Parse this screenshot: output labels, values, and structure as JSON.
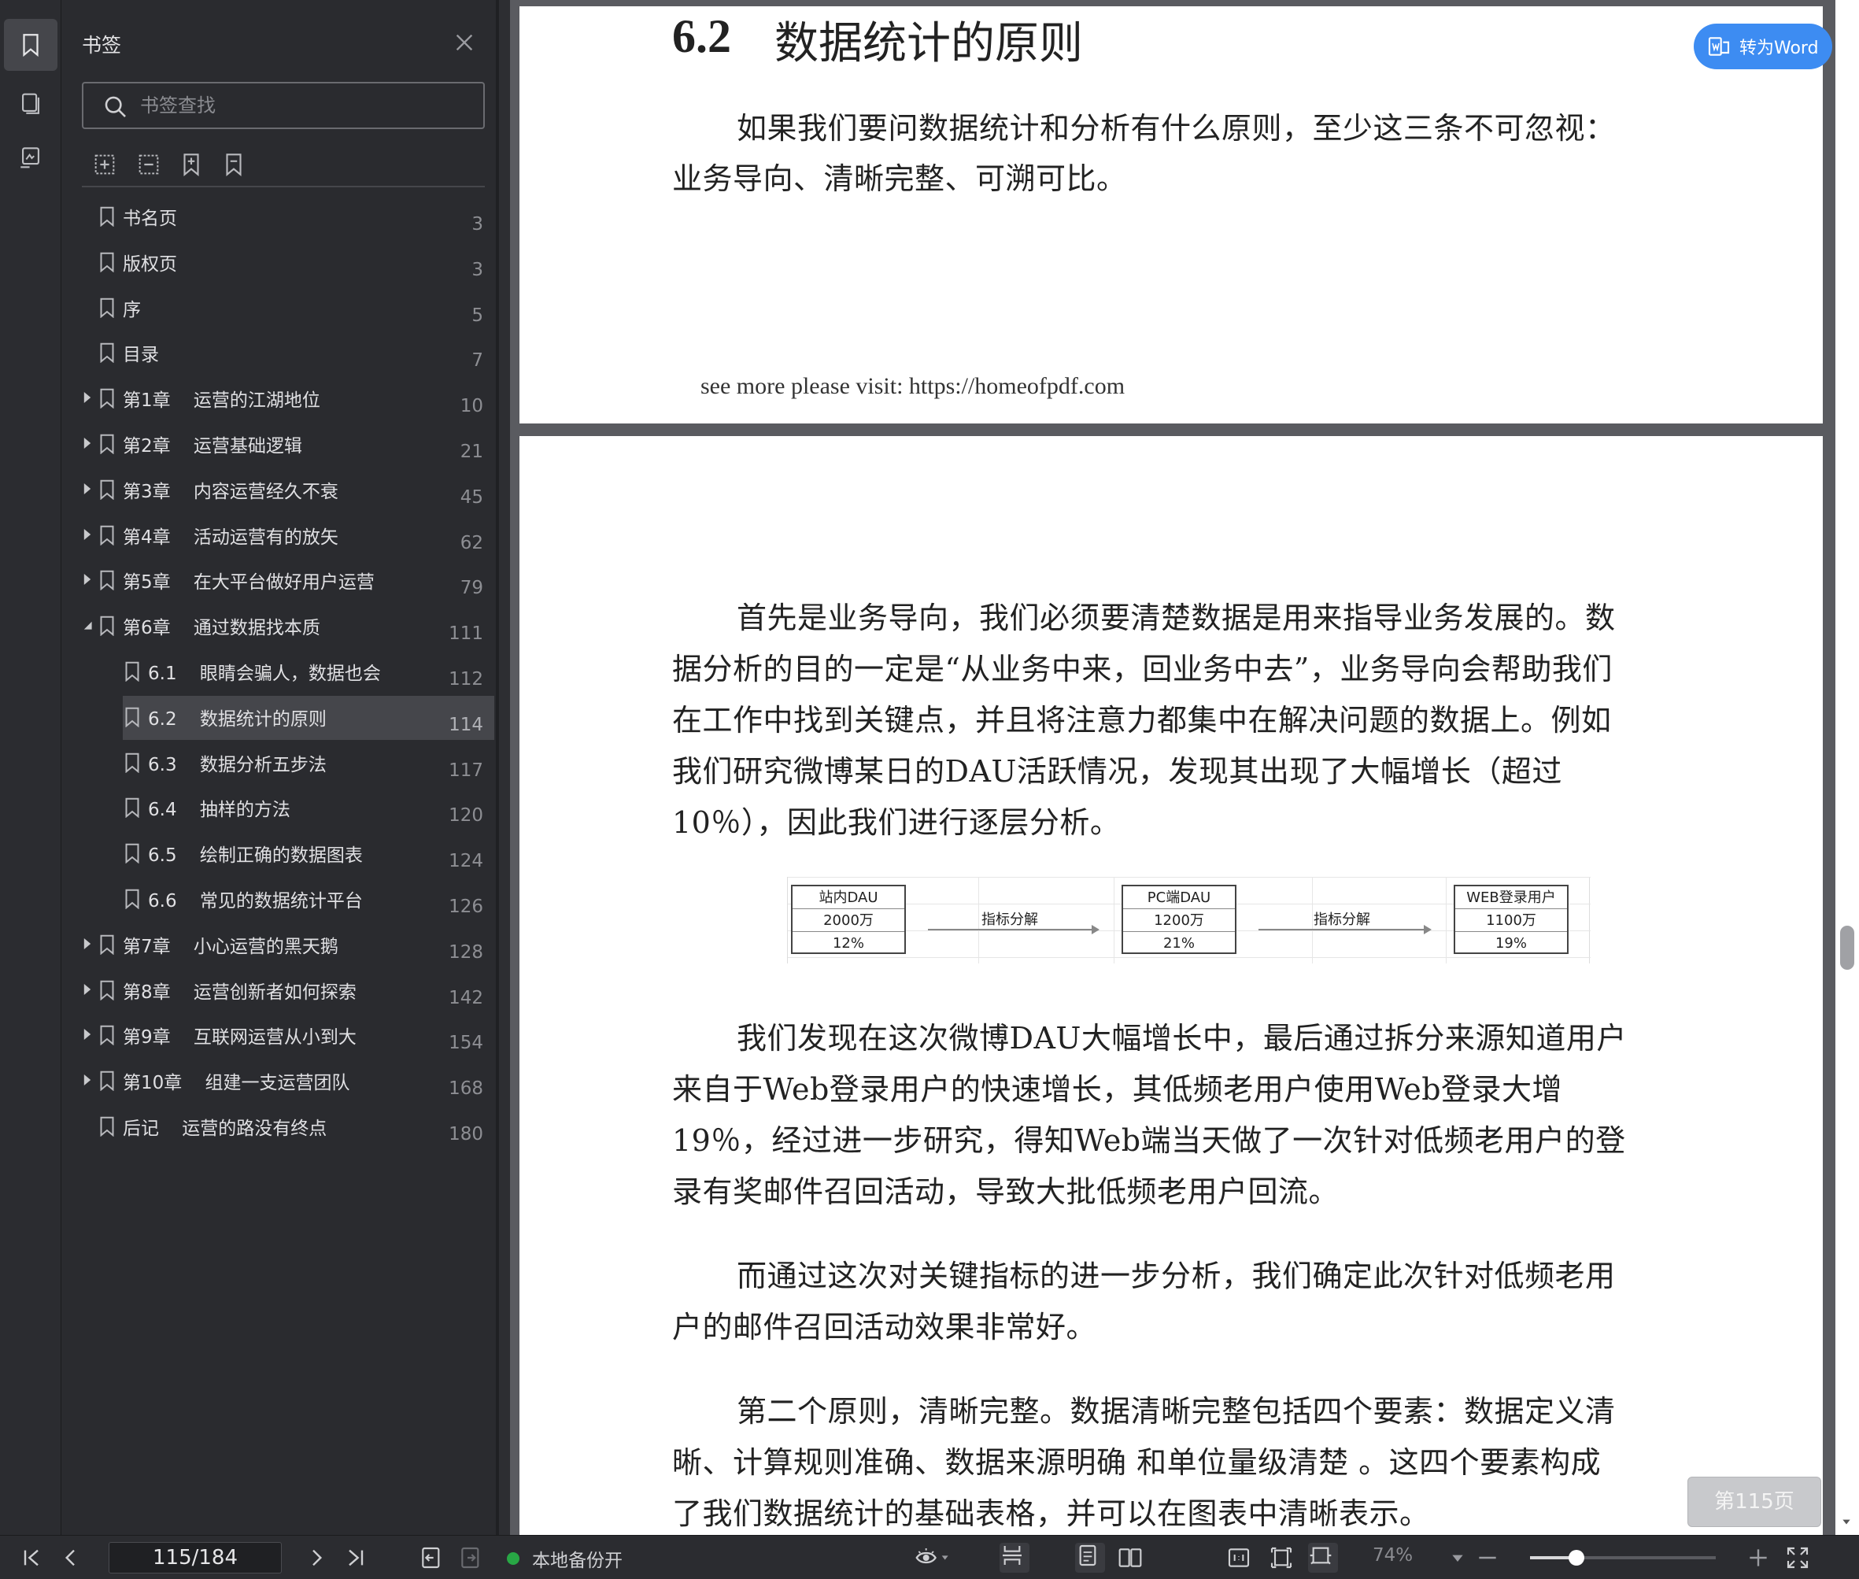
{
  "sidebar": {
    "title": "书签",
    "search_placeholder": "书签查找",
    "items": [
      {
        "label": "书名页",
        "page": "3",
        "level": 0,
        "expandable": false
      },
      {
        "label": "版权页",
        "page": "3",
        "level": 0,
        "expandable": false
      },
      {
        "label": "序",
        "page": "5",
        "level": 0,
        "expandable": false
      },
      {
        "label": "目录",
        "page": "7",
        "level": 0,
        "expandable": false
      },
      {
        "label": "第1章    运营的江湖地位",
        "page": "10",
        "level": 0,
        "expandable": true,
        "expanded": false
      },
      {
        "label": "第2章    运营基础逻辑",
        "page": "21",
        "level": 0,
        "expandable": true,
        "expanded": false
      },
      {
        "label": "第3章    内容运营经久不衰",
        "page": "45",
        "level": 0,
        "expandable": true,
        "expanded": false
      },
      {
        "label": "第4章    活动运营有的放矢",
        "page": "62",
        "level": 0,
        "expandable": true,
        "expanded": false
      },
      {
        "label": "第5章    在大平台做好用户运营",
        "page": "79",
        "level": 0,
        "expandable": true,
        "expanded": false
      },
      {
        "label": "第6章    通过数据找本质",
        "page": "111",
        "level": 0,
        "expandable": true,
        "expanded": true
      },
      {
        "label": "6.1    眼睛会骗人，数据也会",
        "page": "112",
        "level": 1,
        "expandable": false
      },
      {
        "label": "6.2    数据统计的原则",
        "page": "114",
        "level": 1,
        "expandable": false,
        "active": true
      },
      {
        "label": "6.3    数据分析五步法",
        "page": "117",
        "level": 1,
        "expandable": false
      },
      {
        "label": "6.4    抽样的方法",
        "page": "120",
        "level": 1,
        "expandable": false
      },
      {
        "label": "6.5    绘制正确的数据图表",
        "page": "124",
        "level": 1,
        "expandable": false
      },
      {
        "label": "6.6    常见的数据统计平台",
        "page": "126",
        "level": 1,
        "expandable": false
      },
      {
        "label": "第7章    小心运营的黑天鹅",
        "page": "128",
        "level": 0,
        "expandable": true,
        "expanded": false
      },
      {
        "label": "第8章    运营创新者如何探索",
        "page": "142",
        "level": 0,
        "expandable": true,
        "expanded": false
      },
      {
        "label": "第9章    互联网运营从小到大",
        "page": "154",
        "level": 0,
        "expandable": true,
        "expanded": false
      },
      {
        "label": "第10章    组建一支运营团队",
        "page": "168",
        "level": 0,
        "expandable": true,
        "expanded": false
      },
      {
        "label": "后记    运营的路没有终点",
        "page": "180",
        "level": 0,
        "expandable": false
      }
    ]
  },
  "document": {
    "page1": {
      "heading_number": "6.2",
      "heading_title": "数据统计的原则",
      "lines": [
        "如果我们要问数据统计和分析有什么原则，至少这三条不可忽视：",
        "业务导向、清晰完整、可溯可比。"
      ],
      "footer": "see more please visit: https://homeofpdf.com"
    },
    "page2": {
      "para1": [
        "首先是业务导向，我们必须要清楚数据是用来指导业务发展的。数",
        "据分析的目的一定是“从业务中来，回业务中去”，业务导向会帮助我们",
        "在工作中找到关键点，并且将注意力都集中在解决问题的数据上。例如",
        "我们研究微博某日的DAU活跃情况，发现其出现了大幅增长（超过",
        "10％），因此我们进行逐层分析。"
      ],
      "figure": {
        "boxes": [
          {
            "rows": [
              "站内DAU",
              "2000万",
              "12%"
            ]
          },
          {
            "rows": [
              "PC端DAU",
              "1200万",
              "21%"
            ]
          },
          {
            "rows": [
              "WEB登录用户",
              "1100万",
              "19%"
            ]
          }
        ],
        "arrow_label": "指标分解"
      },
      "para2": [
        "我们发现在这次微博DAU大幅增长中，最后通过拆分来源知道用户",
        "来自于Web登录用户的快速增长，其低频老用户使用Web登录大增",
        "19％，经过进一步研究，得知Web端当天做了一次针对低频老用户的登",
        "录有奖邮件召回活动，导致大批低频老用户回流。"
      ],
      "para3": [
        "而通过这次对关键指标的进一步分析，我们确定此次针对低频老用",
        "户的邮件召回活动效果非常好。"
      ],
      "para4": [
        "第二个原则，清晰完整。数据清晰完整包括四个要素：数据定义清",
        "晰、计算规则准确、数据来源明确 和单位量级清楚 。这四个要素构成",
        "了我们数据统计的基础表格，并可以在图表中清晰表示。"
      ]
    },
    "convert_button": "转为Word",
    "page_badge": "第115页"
  },
  "statusbar": {
    "page_value": "115/184",
    "backup_label": "本地备份开",
    "zoom_label": "74%",
    "zoom_level": 0.25
  },
  "colors": {
    "accent": "#3d8cf2",
    "panel_bg": "#2a2b2f",
    "active_item": "#45464b",
    "backup_dot": "#28a745"
  }
}
